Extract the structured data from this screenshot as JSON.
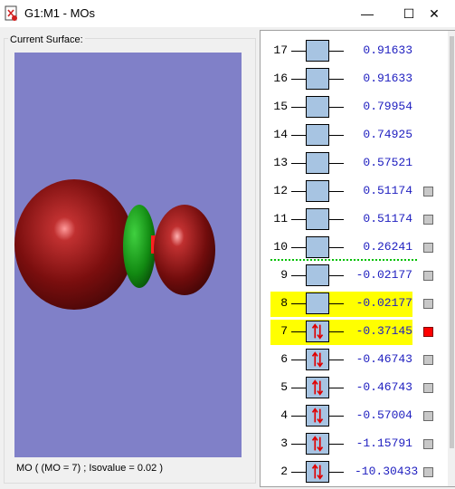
{
  "window": {
    "title": "G1:M1 - MOs",
    "buttons": {
      "minimize": "—",
      "maximize": "☐",
      "close": "✕"
    }
  },
  "surface": {
    "group_label": "Current Surface:",
    "caption": "MO ( (MO = 7) ; Isovalue = 0.02 )",
    "background_color": "#8080c8"
  },
  "orbitals": [
    {
      "index": "17",
      "energy": "0.91633",
      "occupied": false,
      "highlight": false,
      "marker": "none"
    },
    {
      "index": "16",
      "energy": "0.91633",
      "occupied": false,
      "highlight": false,
      "marker": "none"
    },
    {
      "index": "15",
      "energy": "0.79954",
      "occupied": false,
      "highlight": false,
      "marker": "none"
    },
    {
      "index": "14",
      "energy": "0.74925",
      "occupied": false,
      "highlight": false,
      "marker": "none"
    },
    {
      "index": "13",
      "energy": "0.57521",
      "occupied": false,
      "highlight": false,
      "marker": "none"
    },
    {
      "index": "12",
      "energy": "0.51174",
      "occupied": false,
      "highlight": false,
      "marker": "gray"
    },
    {
      "index": "11",
      "energy": "0.51174",
      "occupied": false,
      "highlight": false,
      "marker": "gray"
    },
    {
      "index": "10",
      "energy": "0.26241",
      "occupied": false,
      "highlight": false,
      "marker": "gray"
    },
    {
      "index": "9",
      "energy": "-0.02177",
      "occupied": false,
      "highlight": false,
      "marker": "gray"
    },
    {
      "index": "8",
      "energy": "-0.02177",
      "occupied": false,
      "highlight": true,
      "marker": "gray"
    },
    {
      "index": "7",
      "energy": "-0.37145",
      "occupied": true,
      "highlight": true,
      "marker": "red"
    },
    {
      "index": "6",
      "energy": "-0.46743",
      "occupied": true,
      "highlight": false,
      "marker": "gray"
    },
    {
      "index": "5",
      "energy": "-0.46743",
      "occupied": true,
      "highlight": false,
      "marker": "gray"
    },
    {
      "index": "4",
      "energy": "-0.57004",
      "occupied": true,
      "highlight": false,
      "marker": "gray"
    },
    {
      "index": "3",
      "energy": "-1.15791",
      "occupied": true,
      "highlight": false,
      "marker": "gray"
    },
    {
      "index": "2",
      "energy": "-10.30433",
      "occupied": true,
      "highlight": false,
      "marker": "gray"
    }
  ],
  "colors": {
    "box_fill": "#a7c4e2",
    "highlight": "#ffff00",
    "energy_text": "#2020c0",
    "homo_lumo_line": "#00c000",
    "lobe_dark_red": "#7a0e0e",
    "lobe_green": "#1a9a1a"
  }
}
